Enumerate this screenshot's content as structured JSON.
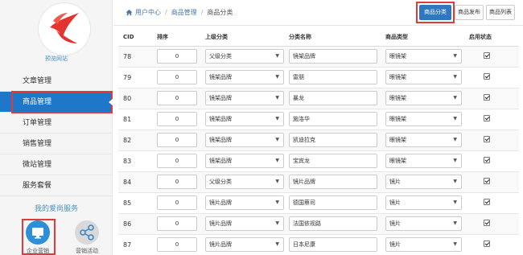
{
  "sidebar": {
    "logo_caption": "预览网站",
    "menu": [
      {
        "label": "文章管理",
        "name": "sidebar-item-articles"
      },
      {
        "label": "商品管理",
        "name": "sidebar-item-products"
      },
      {
        "label": "订单管理",
        "name": "sidebar-item-orders"
      },
      {
        "label": "销售管理",
        "name": "sidebar-item-sales"
      },
      {
        "label": "微站管理",
        "name": "sidebar-item-microsite"
      },
      {
        "label": "服务套餐",
        "name": "sidebar-item-packages"
      }
    ],
    "services_title": "我的爱尚服务",
    "services": [
      {
        "label": "企业营销",
        "icon": "monitor-icon"
      },
      {
        "label": "营销活动",
        "icon": "share-icon"
      }
    ],
    "colors": {
      "accent": "#1e77c8",
      "highlight": "#e03a3a"
    }
  },
  "breadcrumb": {
    "home": "用户中心",
    "section": "商品管理",
    "current": "商品分类"
  },
  "toolbar": {
    "category_label": "商品分类",
    "publish_label": "商品发布",
    "list_label": "商品列表"
  },
  "table": {
    "headers": {
      "cid": "CID",
      "sort": "排序",
      "parent": "上级分类",
      "name": "分类名称",
      "type": "商品类型",
      "enabled": "启用状态"
    },
    "rows": [
      {
        "cid": "78",
        "sort": "0",
        "parent": "父级分类",
        "name": "镜架品牌",
        "type": "眼镜架",
        "enabled": true
      },
      {
        "cid": "79",
        "sort": "0",
        "parent": "镜架品牌",
        "name": "雷朋",
        "type": "眼镜架",
        "enabled": true
      },
      {
        "cid": "80",
        "sort": "0",
        "parent": "镜架品牌",
        "name": "暴龙",
        "type": "眼镜架",
        "enabled": true
      },
      {
        "cid": "81",
        "sort": "0",
        "parent": "镜架品牌",
        "name": "施洛华",
        "type": "眼镜架",
        "enabled": true
      },
      {
        "cid": "82",
        "sort": "0",
        "parent": "镜架品牌",
        "name": "凯迪拉克",
        "type": "眼镜架",
        "enabled": true
      },
      {
        "cid": "83",
        "sort": "0",
        "parent": "镜架品牌",
        "name": "宝宾龙",
        "type": "眼镜架",
        "enabled": true
      },
      {
        "cid": "84",
        "sort": "0",
        "parent": "父级分类",
        "name": "镜片品牌",
        "type": "镜片",
        "enabled": true
      },
      {
        "cid": "85",
        "sort": "0",
        "parent": "镜片品牌",
        "name": "德国蔡司",
        "type": "镜片",
        "enabled": true
      },
      {
        "cid": "86",
        "sort": "0",
        "parent": "镜片品牌",
        "name": "法国依视路",
        "type": "镜片",
        "enabled": true
      },
      {
        "cid": "87",
        "sort": "0",
        "parent": "镜片品牌",
        "name": "日本尼康",
        "type": "镜片",
        "enabled": true
      }
    ]
  }
}
